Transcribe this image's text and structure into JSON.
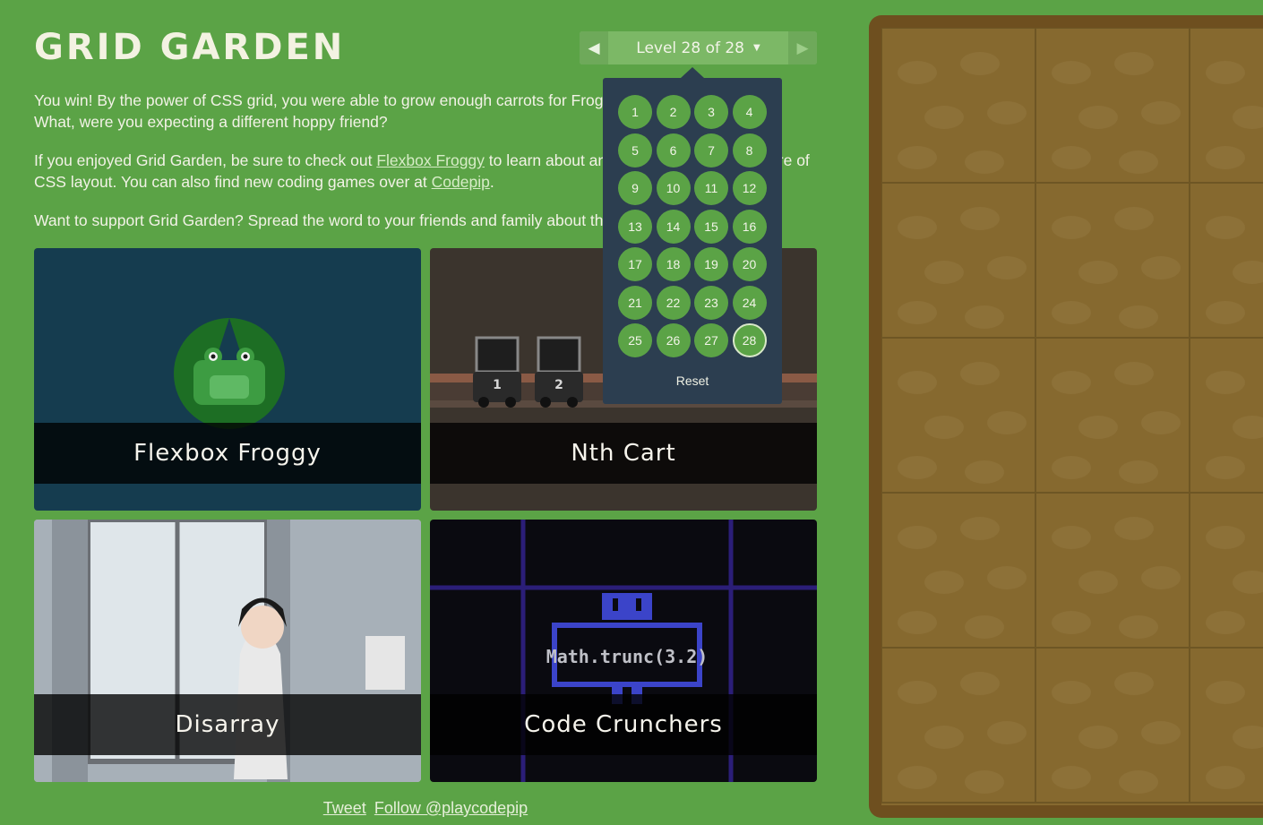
{
  "app": {
    "title": "GRID GARDEN"
  },
  "level_nav": {
    "prev_icon": "triangle-left",
    "next_icon": "triangle-right",
    "label": "Level 28 of 28",
    "caret": "▼",
    "current_level": 28,
    "total_levels": 28
  },
  "instructions": {
    "p1": "You win! By the power of CSS grid, you were able to grow enough carrots for Frog's famous 20-carrot cake. What, were you expecting a different hoppy friend?",
    "p2_before": "If you enjoyed Grid Garden, be sure to check out ",
    "p2_link1": "Flexbox Froggy",
    "p2_mid": " to learn about another powerful new feature of CSS layout. You can also find new coding games over at ",
    "p2_link2": "Codepip",
    "p2_after": ".",
    "p3": "Want to support Grid Garden? Spread the word to your friends and family about this game!"
  },
  "games": [
    {
      "name": "Flexbox Froggy"
    },
    {
      "name": "Nth Cart",
      "cart_labels": [
        "1",
        "2"
      ]
    },
    {
      "name": "Disarray"
    },
    {
      "name": "Code Crunchers",
      "code": "Math.trunc(3.2)"
    }
  ],
  "level_dropdown": {
    "levels": [
      "1",
      "2",
      "3",
      "4",
      "5",
      "6",
      "7",
      "8",
      "9",
      "10",
      "11",
      "12",
      "13",
      "14",
      "15",
      "16",
      "17",
      "18",
      "19",
      "20",
      "21",
      "22",
      "23",
      "24",
      "25",
      "26",
      "27",
      "28"
    ],
    "reset_label": "Reset"
  },
  "footer": {
    "tweet": "Tweet",
    "follow": "Follow @playcodepip"
  },
  "colors": {
    "background": "#5ba346",
    "dropdown_bg": "#2c3e50",
    "soil": "#86692f"
  }
}
